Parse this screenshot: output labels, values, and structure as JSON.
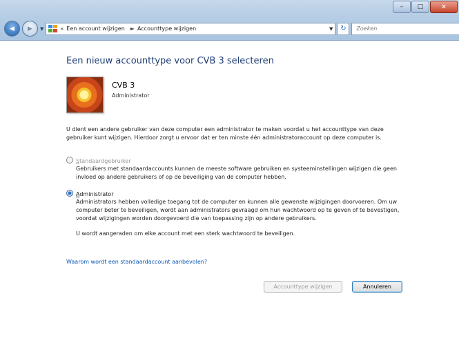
{
  "window": {
    "minimize_glyph": "–",
    "maximize_glyph": "□",
    "close_glyph": "×"
  },
  "address": {
    "back_glyph": "◀",
    "forward_glyph": "▶",
    "history_glyph": "▼",
    "chevron": "«",
    "crumbs": [
      "Een account wijzigen",
      "Accounttype wijzigen"
    ],
    "separator": "►",
    "dropdown_glyph": "▼",
    "refresh_glyph": "↻"
  },
  "search": {
    "placeholder": "Zoeken",
    "icon_glyph": "⚲"
  },
  "page": {
    "title": "Een nieuw accounttype voor CVB 3 selecteren",
    "account_name": "CVB 3",
    "account_type": "Administrator",
    "intro": "U dient een andere gebruiker van deze computer een administrator te maken voordat u het accounttype van deze gebruiker kunt wijzigen. Hierdoor zorgt u ervoor dat er ten minste één administratoraccount op deze computer is.",
    "options": [
      {
        "label": "Standaardgebruiker",
        "accesskey": "S",
        "rest": "tandaardgebruiker",
        "selected": false,
        "disabled": true,
        "description": "Gebruikers met standaardaccounts kunnen de meeste software gebruiken en systeeminstellingen wijzigen die geen invloed op andere gebruikers of op de beveiliging van de computer hebben."
      },
      {
        "label": "Administrator",
        "accesskey": "A",
        "rest": "dministrator",
        "selected": true,
        "disabled": false,
        "description": "Administrators hebben volledige toegang tot de computer en kunnen alle gewenste wijzigingen doorvoeren. Om uw computer beter te beveiligen, wordt aan administrators gevraagd om hun wachtwoord op te geven of te bevestigen, voordat wijzigingen worden doorgevoerd die van toepassing zijn op andere gebruikers.",
        "note": "U wordt aangeraden om elke account met een sterk wachtwoord te beveiligen."
      }
    ],
    "help_link": "Waarom wordt een standaardaccount aanbevolen?",
    "buttons": {
      "change": "Accounttype wijzigen",
      "cancel": "Annuleren"
    }
  }
}
